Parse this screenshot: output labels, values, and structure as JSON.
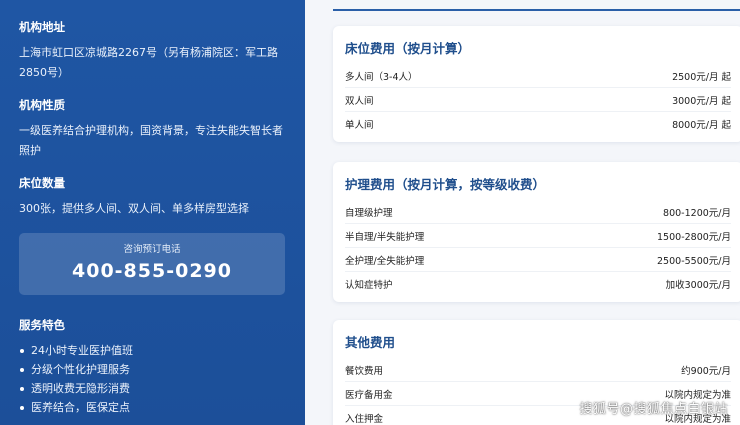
{
  "sidebar": {
    "address": {
      "heading": "机构地址",
      "text": "上海市虹口区凉城路2267号（另有杨浦院区：军工路2850号）"
    },
    "nature": {
      "heading": "机构性质",
      "text": "一级医养结合护理机构，国资背景，专注失能失智长者照护"
    },
    "beds": {
      "heading": "床位数量",
      "text": "300张，提供多人间、双人间、单多样房型选择"
    },
    "phone": {
      "label": "咨询预订电话",
      "number": "400-855-0290"
    },
    "features": {
      "heading": "服务特色",
      "items": [
        "24小时专业医护值班",
        "分级个性化护理服务",
        "透明收费无隐形消费",
        "医养结合，医保定点"
      ]
    }
  },
  "bed_fees": {
    "title": "床位费用（按月计算）",
    "rows": [
      {
        "name": "多人间（3-4人）",
        "price": "2500元/月 起"
      },
      {
        "name": "双人间",
        "price": "3000元/月 起"
      },
      {
        "name": "单人间",
        "price": "8000元/月 起"
      }
    ]
  },
  "care_fees": {
    "title": "护理费用（按月计算，按等级收费）",
    "rows": [
      {
        "name": "自理级护理",
        "price": "800-1200元/月"
      },
      {
        "name": "半自理/半失能护理",
        "price": "1500-2800元/月"
      },
      {
        "name": "全护理/全失能护理",
        "price": "2500-5500元/月"
      },
      {
        "name": "认知症特护",
        "price": "加收3000元/月"
      }
    ]
  },
  "other_fees": {
    "title": "其他费用",
    "rows": [
      {
        "name": "餐饮费用",
        "price": "约900元/月"
      },
      {
        "name": "医疗备用金",
        "price": "以院内规定为准"
      },
      {
        "name": "入住押金",
        "price": "以院内规定为准"
      }
    ]
  },
  "watermark": "搜狐号@搜狐焦点白银站",
  "colors": {
    "sidebar_bg": "#1f56a4",
    "card_title": "#1f4e8c",
    "page_bg": "#f4f6fa"
  }
}
